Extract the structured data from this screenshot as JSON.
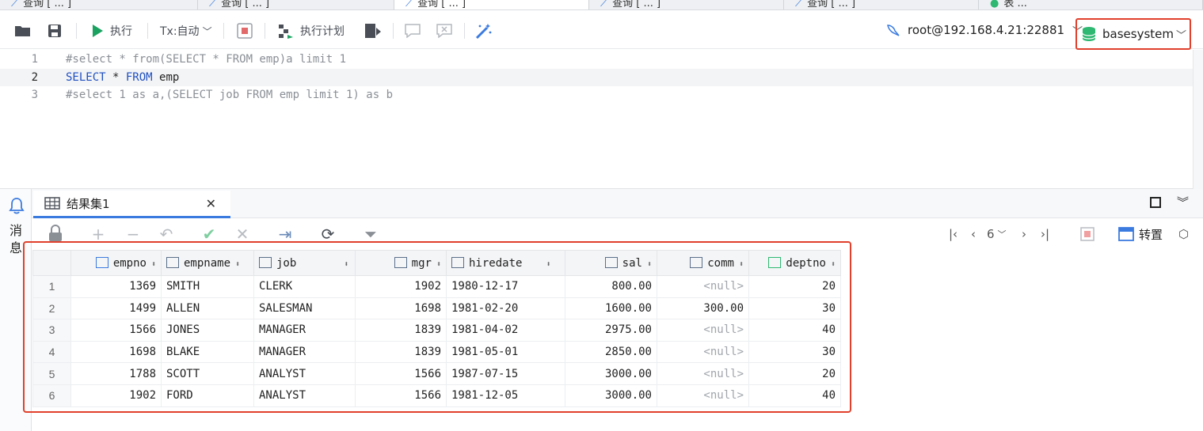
{
  "tabs": [
    {
      "label": "查询 [ ... ]",
      "active": false
    },
    {
      "label": "查询 [ ... ]",
      "active": false
    },
    {
      "label": "查询 [ ... ]",
      "active": true
    },
    {
      "label": "查询 [ ... ]",
      "active": false
    },
    {
      "label": "查询 [ ... ]",
      "active": false
    },
    {
      "label": "表 ...",
      "active": false
    }
  ],
  "toolbar": {
    "execute_label": "执行",
    "tx_label": "Tx:自动",
    "plan_label": "执行计划",
    "connection": "root@192.168.4.21:22881",
    "database": "basesystem"
  },
  "editor": {
    "lines": [
      {
        "num": "1",
        "text": "#select * from(SELECT * FROM emp)a limit 1"
      },
      {
        "num": "2",
        "kw1": "SELECT",
        "mid": " * ",
        "kw2": "FROM",
        "rest": " emp"
      },
      {
        "num": "3",
        "text": "#select 1 as a,(SELECT job FROM emp limit 1) as b"
      }
    ]
  },
  "left_rail": {
    "label": "消息"
  },
  "result": {
    "tab_label": "结果集1",
    "page": "6",
    "pin_label": "转置",
    "columns": [
      "empno",
      "empname",
      "job",
      "mgr",
      "hiredate",
      "sal",
      "comm",
      "deptno"
    ],
    "rows": [
      {
        "rn": "1",
        "empno": "1369",
        "empname": "SMITH",
        "job": "CLERK",
        "mgr": "1902",
        "hiredate": "1980-12-17",
        "sal": "800.00",
        "comm": "<null>",
        "deptno": "20"
      },
      {
        "rn": "2",
        "empno": "1499",
        "empname": "ALLEN",
        "job": "SALESMAN",
        "mgr": "1698",
        "hiredate": "1981-02-20",
        "sal": "1600.00",
        "comm": "300.00",
        "deptno": "30"
      },
      {
        "rn": "3",
        "empno": "1566",
        "empname": "JONES",
        "job": "MANAGER",
        "mgr": "1839",
        "hiredate": "1981-04-02",
        "sal": "2975.00",
        "comm": "<null>",
        "deptno": "40"
      },
      {
        "rn": "4",
        "empno": "1698",
        "empname": "BLAKE",
        "job": "MANAGER",
        "mgr": "1839",
        "hiredate": "1981-05-01",
        "sal": "2850.00",
        "comm": "<null>",
        "deptno": "30"
      },
      {
        "rn": "5",
        "empno": "1788",
        "empname": "SCOTT",
        "job": "ANALYST",
        "mgr": "1566",
        "hiredate": "1987-07-15",
        "sal": "3000.00",
        "comm": "<null>",
        "deptno": "20"
      },
      {
        "rn": "6",
        "empno": "1902",
        "empname": "FORD",
        "job": "ANALYST",
        "mgr": "1566",
        "hiredate": "1981-12-05",
        "sal": "3000.00",
        "comm": "<null>",
        "deptno": "40"
      }
    ]
  },
  "colors": {
    "accent": "#3b7be0",
    "highlight_border": "#e0402c",
    "db_icon": "#2eb872",
    "run_icon": "#1aa260"
  }
}
